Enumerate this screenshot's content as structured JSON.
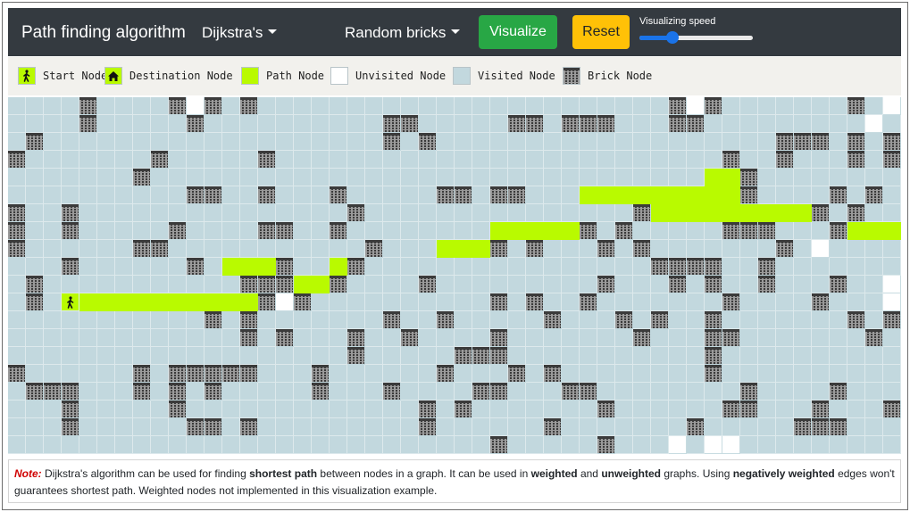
{
  "navbar": {
    "brand": "Path finding algorithm",
    "algorithm_selected": "Dijkstra's",
    "maze_selected": "Random bricks",
    "visualize_label": "Visualize",
    "reset_label": "Reset",
    "speed_label": "Visualizing speed",
    "speed_fraction": 0.29
  },
  "colors": {
    "navbar_bg": "#343a40",
    "visualize_btn": "#28a745",
    "reset_btn": "#ffc107",
    "path": "#b9fa00",
    "visited": "#c2d8de",
    "unvisited": "#ffffff",
    "brick": "#3b3b3b",
    "note_label": "#d00000"
  },
  "legend": [
    {
      "key": "start",
      "label": "Start Node",
      "icon": "walking-person-icon"
    },
    {
      "key": "dest",
      "label": "Destination Node",
      "icon": "home-icon"
    },
    {
      "key": "path",
      "label": "Path Node"
    },
    {
      "key": "unvisited",
      "label": "Unvisited Node"
    },
    {
      "key": "visited",
      "label": "Visited Node"
    },
    {
      "key": "brick",
      "label": "Brick Node"
    }
  ],
  "grid": {
    "rows": 20,
    "cols": 50,
    "legend_codes": ". visited, # brick, * path, o unvisited, S start, D destination",
    "cells": [
      "....#....#o#.#.......................#o#.......#.o",
      "....#.....#..........##.....##.###...##.........o.",
      ".#...................#.#...................###.#.#o",
      "#.......#.....#.........................#..#...#.##o",
      ".......#...............................**#........",
      "..........##..#...#.....##.##...*********#....#.#.",
      "#..#...............#...............#*********#.#...",
      "#..#.....#....##..#........*****#.#.....###...#*****D",
      "#......##...........#...***#.#...#.#.......#.o",
      "...#......#.***#..*#................####..#.......o",
      ".#...........###**#....#.........#...#.#..#...#..o",
      ".#.S**********#o#..........#.#..#.......#....#...o",
      "...........#.#.......#..#.....#...#.#..#.......#.#",
      ".............#.#...#..#....#.......#...##.......#..",
      "...................#.....###...........#.........",
      "#......#.#####...#......#...#.#........#...........",
      ".###...#.#.#.....#...#....##...##........#....#..",
      "...#.....#.............#.#.......#......##...#...#.",
      "...#......##.#.........#......#.......#.....###",
      "...........................#.....#...o.oo"
    ]
  },
  "note": {
    "label": "Note:",
    "parts": [
      {
        "text": " Dijkstra's algorithm can be used for finding ",
        "bold": false
      },
      {
        "text": "shortest path",
        "bold": true
      },
      {
        "text": " between nodes in a graph. It can be used in ",
        "bold": false
      },
      {
        "text": "weighted",
        "bold": true
      },
      {
        "text": " and ",
        "bold": false
      },
      {
        "text": "unweighted",
        "bold": true
      },
      {
        "text": " graphs. Using ",
        "bold": false
      },
      {
        "text": "negatively weighted",
        "bold": true
      },
      {
        "text": " edges won't guarantees shortest path. Weighted nodes not implemented in this visualization example.",
        "bold": false
      }
    ]
  }
}
